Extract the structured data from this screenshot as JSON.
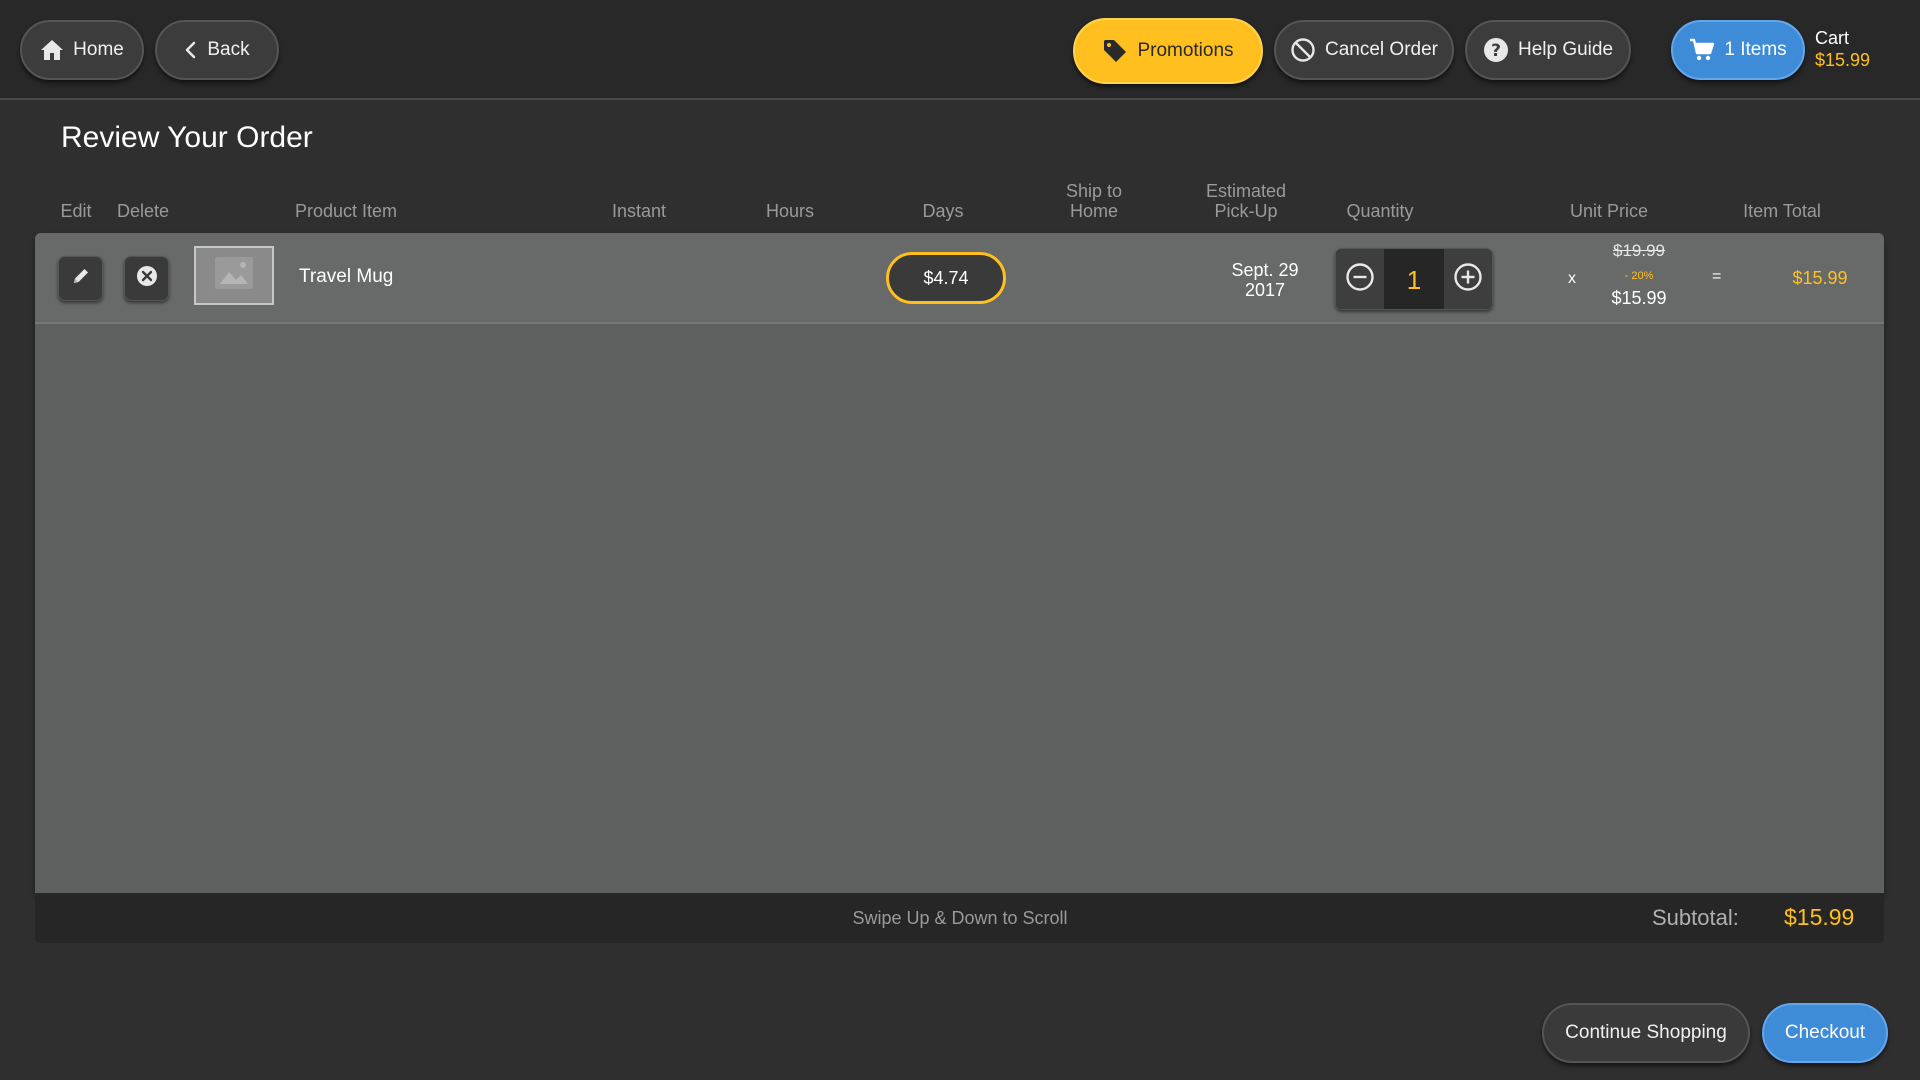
{
  "header": {
    "home_label": "Home",
    "back_label": "Back",
    "promotions_label": "Promotions",
    "cancel_label": "Cancel Order",
    "help_label": "Help Guide",
    "cart_items_label": "1 Items",
    "cart_label": "Cart",
    "cart_total": "$15.99"
  },
  "page": {
    "title": "Review Your Order"
  },
  "columns": {
    "edit": "Edit",
    "delete": "Delete",
    "product": "Product Item",
    "instant": "Instant",
    "hours": "Hours",
    "days": "Days",
    "ship_line1": "Ship to",
    "ship_line2": "Home",
    "pickup_line1": "Estimated",
    "pickup_line2": "Pick-Up",
    "quantity": "Quantity",
    "unit_price": "Unit Price",
    "item_total": "Item Total"
  },
  "items": [
    {
      "name": "Travel Mug",
      "days_price": "$4.74",
      "pickup_line1": "Sept. 29",
      "pickup_line2": "2017",
      "quantity": "1",
      "times": "x",
      "unit_original": "$19.99",
      "discount": "- 20%",
      "unit_price": "$15.99",
      "equals": "=",
      "item_total": "$15.99"
    }
  ],
  "footer": {
    "scroll_hint": "Swipe Up & Down to Scroll",
    "subtotal_label": "Subtotal:",
    "subtotal_value": "$15.99"
  },
  "actions": {
    "continue_label": "Continue Shopping",
    "checkout_label": "Checkout"
  },
  "colors": {
    "accent_yellow": "#ffc01f",
    "accent_blue": "#3e8bd8",
    "background": "#2f2f2f"
  },
  "icons": [
    "home-icon",
    "chevron-left-icon",
    "tag-icon",
    "cancel-icon",
    "help-icon",
    "cart-icon",
    "pencil-icon",
    "close-circle-icon",
    "image-placeholder-icon",
    "minus-circle-icon",
    "plus-circle-icon"
  ]
}
